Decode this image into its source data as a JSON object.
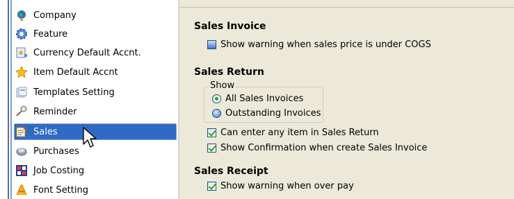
{
  "nav": {
    "items": [
      {
        "label": "Company",
        "icon": "globe-icon"
      },
      {
        "label": "Feature",
        "icon": "gear-icon"
      },
      {
        "label": "Currency Default Accnt.",
        "icon": "currency-document-icon"
      },
      {
        "label": "Item Default Accnt",
        "icon": "star-icon"
      },
      {
        "label": "Templates Setting",
        "icon": "templates-icon"
      },
      {
        "label": "Reminder",
        "icon": "reminder-icon"
      },
      {
        "label": "Sales",
        "icon": "sales-icon",
        "selected": true
      },
      {
        "label": "Purchases",
        "icon": "purchases-icon"
      },
      {
        "label": "Job Costing",
        "icon": "grid-icon"
      },
      {
        "label": "Font Setting",
        "icon": "font-icon"
      }
    ]
  },
  "sales_invoice": {
    "title": "Sales Invoice",
    "warning_label": "Show warning when sales price is under COGS",
    "warning_checked": false
  },
  "sales_return": {
    "title": "Sales Return",
    "show_group_label": "Show",
    "radio_all": "All Sales Invoices",
    "radio_outstanding": "Outstanding Invoices",
    "selected_option": "All Sales Invoices",
    "can_enter_label": "Can enter any item in Sales Return",
    "can_enter_checked": true,
    "confirm_label": "Show Confirmation when create Sales Invoice",
    "confirm_checked": true
  },
  "sales_receipt": {
    "title": "Sales Receipt",
    "overpay_label": "Show warning when over pay",
    "overpay_checked": true
  },
  "colors": {
    "selection": "#316ac5",
    "panel": "#ece9d8",
    "check": "#21a121"
  }
}
